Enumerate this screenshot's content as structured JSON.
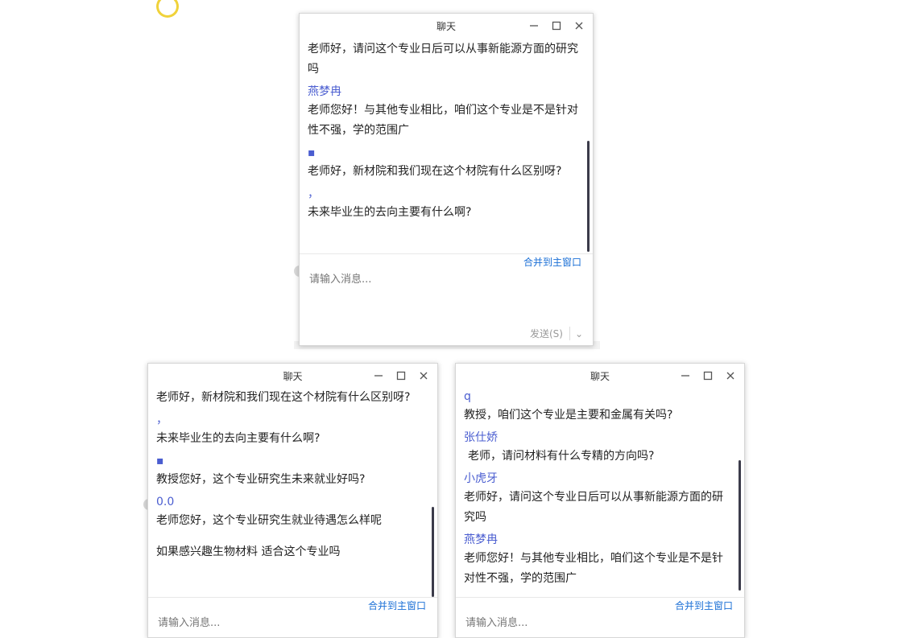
{
  "windows": [
    {
      "title": "聊天",
      "messages": [
        {
          "sender": "",
          "text": "老师好，请问这个专业日后可以从事新能源方面的研究吗"
        },
        {
          "sender": "燕梦冉",
          "text": "老师您好！与其他专业相比，咱们这个专业是不是针对性不强，学的范围广"
        },
        {
          "sender": "▪",
          "text": "老师好，新材院和我们现在这个材院有什么区别呀?"
        },
        {
          "sender": "，",
          "text": "未来毕业生的去向主要有什么啊?"
        }
      ],
      "merge_label": "合并到主窗口",
      "input_placeholder": "请输入消息...",
      "send_label": "发送(S)",
      "send_arrow": "⌄"
    },
    {
      "title": "聊天",
      "messages": [
        {
          "sender": "",
          "text": "老师好，新材院和我们现在这个材院有什么区别呀?"
        },
        {
          "sender": "，",
          "text": "未来毕业生的去向主要有什么啊?"
        },
        {
          "sender": "▪",
          "text": "教授您好，这个专业研究生未来就业好吗?"
        },
        {
          "sender": "0.0",
          "text": "老师您好，这个专业研究生就业待遇怎么样呢"
        },
        {
          "sender": "",
          "text": "如果感兴趣生物材料  适合这个专业吗"
        }
      ],
      "merge_label": "合并到主窗口",
      "input_placeholder": "请输入消息..."
    },
    {
      "title": "聊天",
      "messages": [
        {
          "sender": "q",
          "text": "教授，咱们这个专业是主要和金属有关吗?"
        },
        {
          "sender": "张仕娇",
          "text": "老师，请问材料有什么专精的方向吗?"
        },
        {
          "sender": "小虎牙",
          "text": "老师好，请问这个专业日后可以从事新能源方面的研究吗"
        },
        {
          "sender": "燕梦冉",
          "text": "老师您好！与其他专业相比，咱们这个专业是不是针对性不强，学的范围广"
        }
      ],
      "merge_label": "合并到主窗口",
      "input_placeholder": "请输入消息..."
    }
  ]
}
